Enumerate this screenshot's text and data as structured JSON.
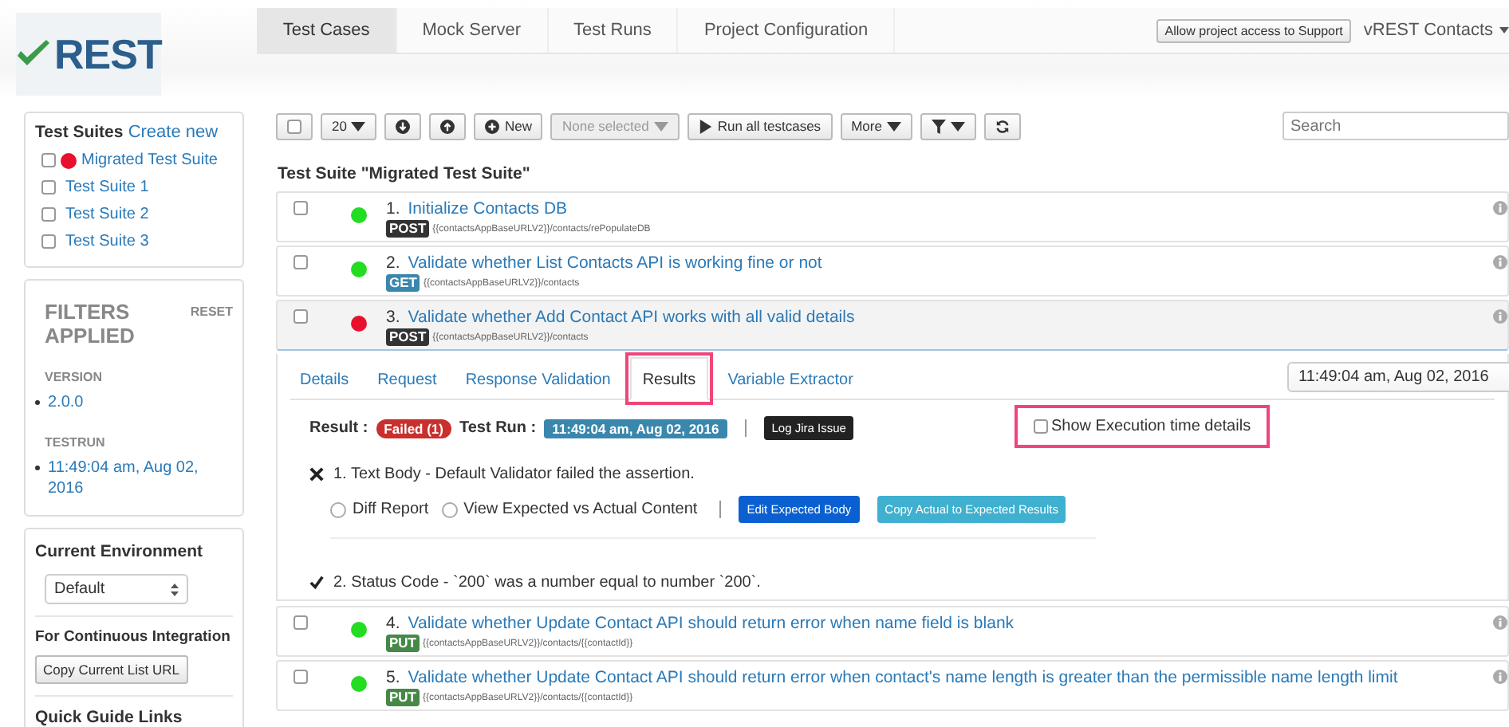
{
  "header": {
    "logo": "REST",
    "nav_tabs": [
      {
        "label": "Test Cases",
        "selected": true
      },
      {
        "label": "Mock Server",
        "selected": false
      },
      {
        "label": "Test Runs",
        "selected": false
      },
      {
        "label": "Project Configuration",
        "selected": false
      }
    ],
    "support_button": "Allow project access to Support",
    "account_menu": "vREST Contacts"
  },
  "sidebar": {
    "suites_title": "Test Suites",
    "create_link": "Create new",
    "suites": [
      {
        "label": "Migrated Test Suite",
        "checked": false,
        "color": "#e8102e"
      },
      {
        "label": "Test Suite 1",
        "checked": false
      },
      {
        "label": "Test Suite 2",
        "checked": false
      },
      {
        "label": "Test Suite 3",
        "checked": false
      }
    ],
    "filters_title": "FILTERS APPLIED",
    "reset": "RESET",
    "filter_groups": [
      {
        "label": "VERSION",
        "values": [
          "2.0.0"
        ]
      },
      {
        "label": "TESTRUN",
        "values": [
          "11:49:04 am, Aug 02, 2016"
        ]
      }
    ],
    "environment_title": "Current Environment",
    "environment_value": "Default",
    "ci_title": "For Continuous Integration",
    "ci_button": "Copy Current List URL",
    "quick_guide_title": "Quick Guide Links"
  },
  "toolbar": {
    "select_all_checked": false,
    "page_size": "20",
    "new_button": "New",
    "selection_menu": "None selected",
    "run_button": "Run all testcases",
    "more_menu": "More",
    "search_placeholder": "Search"
  },
  "suite_title": "Test Suite \"Migrated Test Suite\"",
  "test_cases": [
    {
      "number": "1.",
      "title": "Initialize Contacts DB",
      "method": "POST",
      "color": "#333333",
      "url": "{{contactsAppBaseURLV2}}/contacts/rePopulateDB",
      "failed": false,
      "checked": false,
      "expanded": false
    },
    {
      "number": "2.",
      "title": "Validate whether List Contacts API is working fine or not",
      "method": "GET",
      "color": "#3a87ad",
      "url": "{{contactsAppBaseURLV2}}/contacts",
      "failed": false,
      "checked": false,
      "expanded": false
    },
    {
      "number": "3.",
      "title": "Validate whether Add Contact API works with all valid details",
      "method": "POST",
      "color": "#333333",
      "url": "{{contactsAppBaseURLV2}}/contacts",
      "failed": true,
      "checked": false,
      "expanded": true
    },
    {
      "number": "4.",
      "title": "Validate whether Update Contact API should return error when name field is blank",
      "method": "PUT",
      "color": "#468847",
      "url": "{{contactsAppBaseURLV2}}/contacts/{{contactId}}",
      "failed": false,
      "checked": false,
      "expanded": false
    },
    {
      "number": "5.",
      "title": "Validate whether Update Contact API should return error when contact's name length is greater than the permissible name length limit",
      "method": "PUT",
      "color": "#468847",
      "url": "{{contactsAppBaseURLV2}}/contacts/{{contactId}}",
      "failed": false,
      "checked": false,
      "expanded": false
    }
  ],
  "details": {
    "tabs": [
      {
        "label": "Details",
        "selected": false
      },
      {
        "label": "Request",
        "selected": false
      },
      {
        "label": "Response Validation",
        "selected": false
      },
      {
        "label": "Results",
        "selected": true
      },
      {
        "label": "Variable Extractor",
        "selected": false
      }
    ],
    "run_select": "11:49:04 am, Aug 02, 2016",
    "result_label": "Result :",
    "result_badge": "Failed (1)",
    "test_run_label": "Test Run :",
    "test_run_badge": "11:49:04 am, Aug 02, 2016",
    "log_button": "Log Jira Issue",
    "exec_details_label": "Show Execution time details",
    "exec_details_checked": false,
    "assertions": [
      {
        "kind": "fail",
        "text": "1. Text Body - Default Validator failed the assertion.",
        "options": [
          {
            "label": "Diff Report",
            "selected": false
          },
          {
            "label": "View Expected vs Actual Content",
            "selected": false
          }
        ],
        "edit_button": "Edit Expected Body",
        "copy_button": "Copy Actual to Expected Results"
      },
      {
        "kind": "pass",
        "text": "2. Status Code - `200` was a number equal to number `200`."
      }
    ]
  }
}
